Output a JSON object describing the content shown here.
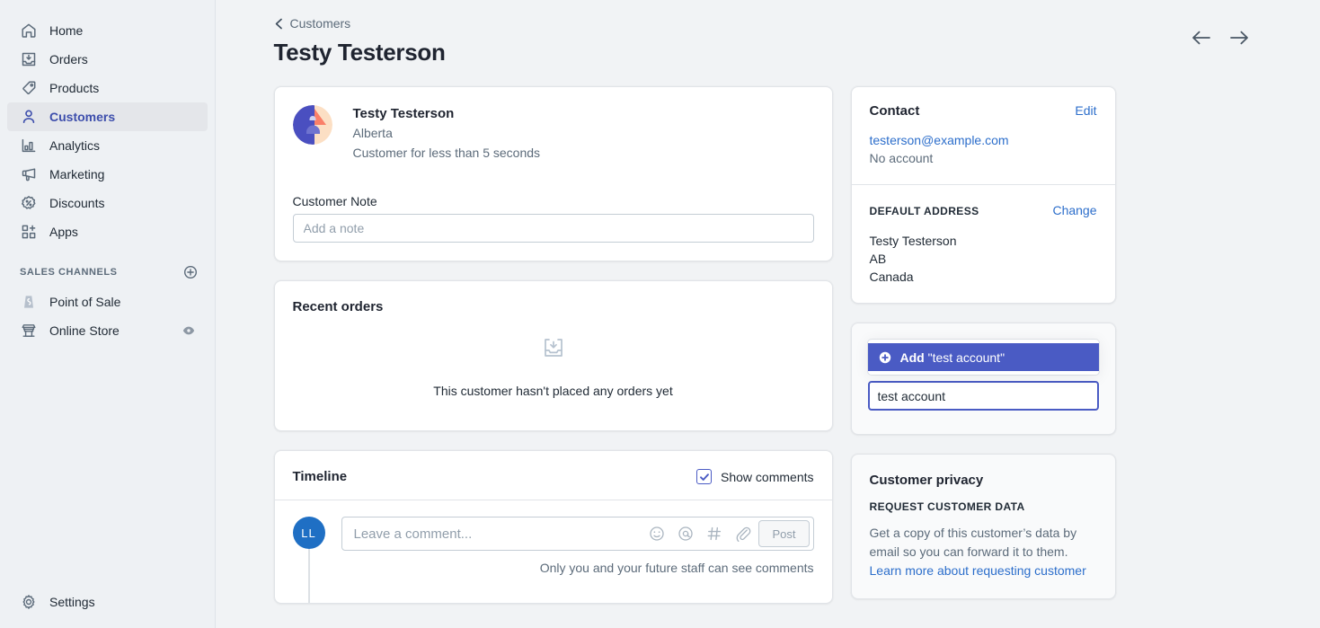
{
  "sidebar": {
    "items": [
      {
        "label": "Home",
        "icon": "home-icon",
        "active": false
      },
      {
        "label": "Orders",
        "icon": "orders-inbox-icon",
        "active": false
      },
      {
        "label": "Products",
        "icon": "product-tag-icon",
        "active": false
      },
      {
        "label": "Customers",
        "icon": "person-icon",
        "active": true
      },
      {
        "label": "Analytics",
        "icon": "bar-chart-icon",
        "active": false
      },
      {
        "label": "Marketing",
        "icon": "megaphone-icon",
        "active": false
      },
      {
        "label": "Discounts",
        "icon": "discount-percent-icon",
        "active": false
      },
      {
        "label": "Apps",
        "icon": "apps-grid-plus-icon",
        "active": false
      }
    ],
    "section": {
      "title": "SALES CHANNELS",
      "add_icon": "circle-plus-icon",
      "channels": [
        {
          "label": "Point of Sale",
          "icon": "point-of-sale-icon",
          "trailing_icon": ""
        },
        {
          "label": "Online Store",
          "icon": "storefront-icon",
          "trailing_icon": "eye-icon"
        }
      ]
    },
    "settings": {
      "label": "Settings",
      "icon": "gear-icon"
    }
  },
  "header": {
    "breadcrumb": "Customers",
    "breadcrumb_icon": "chevron-left-icon",
    "title": "Testy Testerson",
    "prev_icon": "arrow-left-icon",
    "next_icon": "arrow-right-icon"
  },
  "customer_card": {
    "avatar_name": "customer-avatar",
    "name": "Testy Testerson",
    "location": "Alberta",
    "tenure": "Customer for less than 5 seconds",
    "note_label": "Customer Note",
    "note_value": "",
    "note_placeholder": "Add a note"
  },
  "recent_orders": {
    "title": "Recent orders",
    "empty_icon": "inbox-download-icon",
    "empty_text": "This customer hasn't placed any orders yet"
  },
  "timeline": {
    "title": "Timeline",
    "show_comments_label": "Show comments",
    "show_comments_checked": true,
    "avatar_initials": "LL",
    "comment_placeholder": "Leave a comment...",
    "tools": [
      "emoji-smiley-icon",
      "mention-at-icon",
      "hashtag-icon",
      "attachment-paperclip-icon"
    ],
    "post_label": "Post",
    "hint": "Only you and your future staff can see comments"
  },
  "contact": {
    "title": "Contact",
    "edit_label": "Edit",
    "email": "testerson@example.com",
    "account_status": "No account",
    "address_heading": "DEFAULT ADDRESS",
    "change_label": "Change",
    "address_lines": [
      "Testy Testerson",
      "AB",
      "Canada"
    ]
  },
  "tags": {
    "option_add_icon": "circle-plus-filled-icon",
    "option_prefix": "Add",
    "option_value": "\"test account\"",
    "input_value": "test account"
  },
  "privacy": {
    "title": "Customer privacy",
    "subheading": "REQUEST CUSTOMER DATA",
    "paragraph": "Get a copy of this customer’s data by email so you can forward it to them.",
    "link_text": "Learn more about requesting customer"
  },
  "colors": {
    "accent_indigo": "#4a5bc4",
    "link_blue": "#2c6ecb",
    "nav_active": "#3d4eac",
    "avatar_blue": "#1f6fc4",
    "page_bg": "#f1f3f5",
    "sidebar_bg": "#eef1f4"
  }
}
